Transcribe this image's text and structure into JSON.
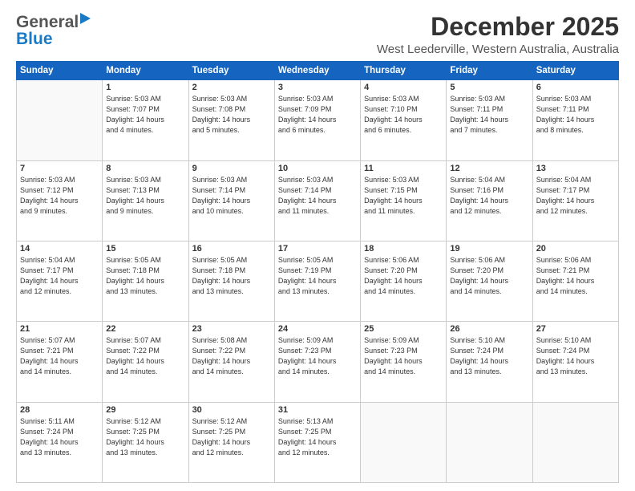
{
  "header": {
    "logo_general": "General",
    "logo_blue": "Blue",
    "main_title": "December 2025",
    "sub_title": "West Leederville, Western Australia, Australia"
  },
  "calendar": {
    "days_of_week": [
      "Sunday",
      "Monday",
      "Tuesday",
      "Wednesday",
      "Thursday",
      "Friday",
      "Saturday"
    ],
    "weeks": [
      [
        {
          "day": "",
          "info": ""
        },
        {
          "day": "1",
          "info": "Sunrise: 5:03 AM\nSunset: 7:07 PM\nDaylight: 14 hours\nand 4 minutes."
        },
        {
          "day": "2",
          "info": "Sunrise: 5:03 AM\nSunset: 7:08 PM\nDaylight: 14 hours\nand 5 minutes."
        },
        {
          "day": "3",
          "info": "Sunrise: 5:03 AM\nSunset: 7:09 PM\nDaylight: 14 hours\nand 6 minutes."
        },
        {
          "day": "4",
          "info": "Sunrise: 5:03 AM\nSunset: 7:10 PM\nDaylight: 14 hours\nand 6 minutes."
        },
        {
          "day": "5",
          "info": "Sunrise: 5:03 AM\nSunset: 7:11 PM\nDaylight: 14 hours\nand 7 minutes."
        },
        {
          "day": "6",
          "info": "Sunrise: 5:03 AM\nSunset: 7:11 PM\nDaylight: 14 hours\nand 8 minutes."
        }
      ],
      [
        {
          "day": "7",
          "info": "Sunrise: 5:03 AM\nSunset: 7:12 PM\nDaylight: 14 hours\nand 9 minutes."
        },
        {
          "day": "8",
          "info": "Sunrise: 5:03 AM\nSunset: 7:13 PM\nDaylight: 14 hours\nand 9 minutes."
        },
        {
          "day": "9",
          "info": "Sunrise: 5:03 AM\nSunset: 7:14 PM\nDaylight: 14 hours\nand 10 minutes."
        },
        {
          "day": "10",
          "info": "Sunrise: 5:03 AM\nSunset: 7:14 PM\nDaylight: 14 hours\nand 11 minutes."
        },
        {
          "day": "11",
          "info": "Sunrise: 5:03 AM\nSunset: 7:15 PM\nDaylight: 14 hours\nand 11 minutes."
        },
        {
          "day": "12",
          "info": "Sunrise: 5:04 AM\nSunset: 7:16 PM\nDaylight: 14 hours\nand 12 minutes."
        },
        {
          "day": "13",
          "info": "Sunrise: 5:04 AM\nSunset: 7:17 PM\nDaylight: 14 hours\nand 12 minutes."
        }
      ],
      [
        {
          "day": "14",
          "info": "Sunrise: 5:04 AM\nSunset: 7:17 PM\nDaylight: 14 hours\nand 12 minutes."
        },
        {
          "day": "15",
          "info": "Sunrise: 5:05 AM\nSunset: 7:18 PM\nDaylight: 14 hours\nand 13 minutes."
        },
        {
          "day": "16",
          "info": "Sunrise: 5:05 AM\nSunset: 7:18 PM\nDaylight: 14 hours\nand 13 minutes."
        },
        {
          "day": "17",
          "info": "Sunrise: 5:05 AM\nSunset: 7:19 PM\nDaylight: 14 hours\nand 13 minutes."
        },
        {
          "day": "18",
          "info": "Sunrise: 5:06 AM\nSunset: 7:20 PM\nDaylight: 14 hours\nand 14 minutes."
        },
        {
          "day": "19",
          "info": "Sunrise: 5:06 AM\nSunset: 7:20 PM\nDaylight: 14 hours\nand 14 minutes."
        },
        {
          "day": "20",
          "info": "Sunrise: 5:06 AM\nSunset: 7:21 PM\nDaylight: 14 hours\nand 14 minutes."
        }
      ],
      [
        {
          "day": "21",
          "info": "Sunrise: 5:07 AM\nSunset: 7:21 PM\nDaylight: 14 hours\nand 14 minutes."
        },
        {
          "day": "22",
          "info": "Sunrise: 5:07 AM\nSunset: 7:22 PM\nDaylight: 14 hours\nand 14 minutes."
        },
        {
          "day": "23",
          "info": "Sunrise: 5:08 AM\nSunset: 7:22 PM\nDaylight: 14 hours\nand 14 minutes."
        },
        {
          "day": "24",
          "info": "Sunrise: 5:09 AM\nSunset: 7:23 PM\nDaylight: 14 hours\nand 14 minutes."
        },
        {
          "day": "25",
          "info": "Sunrise: 5:09 AM\nSunset: 7:23 PM\nDaylight: 14 hours\nand 14 minutes."
        },
        {
          "day": "26",
          "info": "Sunrise: 5:10 AM\nSunset: 7:24 PM\nDaylight: 14 hours\nand 13 minutes."
        },
        {
          "day": "27",
          "info": "Sunrise: 5:10 AM\nSunset: 7:24 PM\nDaylight: 14 hours\nand 13 minutes."
        }
      ],
      [
        {
          "day": "28",
          "info": "Sunrise: 5:11 AM\nSunset: 7:24 PM\nDaylight: 14 hours\nand 13 minutes."
        },
        {
          "day": "29",
          "info": "Sunrise: 5:12 AM\nSunset: 7:25 PM\nDaylight: 14 hours\nand 13 minutes."
        },
        {
          "day": "30",
          "info": "Sunrise: 5:12 AM\nSunset: 7:25 PM\nDaylight: 14 hours\nand 12 minutes."
        },
        {
          "day": "31",
          "info": "Sunrise: 5:13 AM\nSunset: 7:25 PM\nDaylight: 14 hours\nand 12 minutes."
        },
        {
          "day": "",
          "info": ""
        },
        {
          "day": "",
          "info": ""
        },
        {
          "day": "",
          "info": ""
        }
      ]
    ]
  }
}
